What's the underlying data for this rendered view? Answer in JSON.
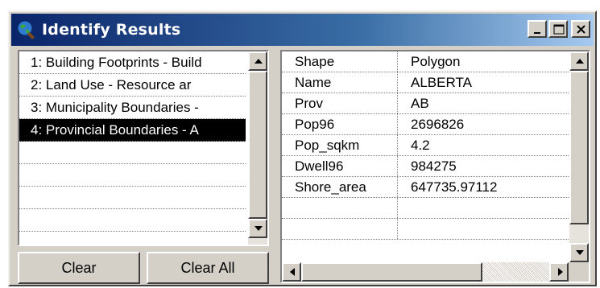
{
  "window": {
    "title": "Identify Results",
    "icon": "identify-globe-icon",
    "controls": [
      "minimize-icon",
      "maximize-icon",
      "close-icon"
    ]
  },
  "layers": {
    "items": [
      {
        "label": "1:  Building Footprints - Build"
      },
      {
        "label": "2:  Land Use - Resource ar"
      },
      {
        "label": "3:  Municipality Boundaries -"
      },
      {
        "label": "4:  Provincial Boundaries - A"
      }
    ],
    "selected_index": 3
  },
  "buttons": {
    "clear": "Clear",
    "clear_all": "Clear All"
  },
  "attributes": {
    "rows": [
      {
        "field": "Shape",
        "value": "Polygon"
      },
      {
        "field": "Name",
        "value": "ALBERTA"
      },
      {
        "field": "Prov",
        "value": "AB"
      },
      {
        "field": "Pop96",
        "value": "2696826"
      },
      {
        "field": "Pop_sqkm",
        "value": "4.2"
      },
      {
        "field": "Dwell96",
        "value": "984275"
      },
      {
        "field": "Shore_area",
        "value": "647735.97112"
      }
    ]
  },
  "colors": {
    "titlebar_start": "#0a246a",
    "titlebar_end": "#a6caf0",
    "face": "#d4d0c8",
    "selection": "#000000"
  }
}
